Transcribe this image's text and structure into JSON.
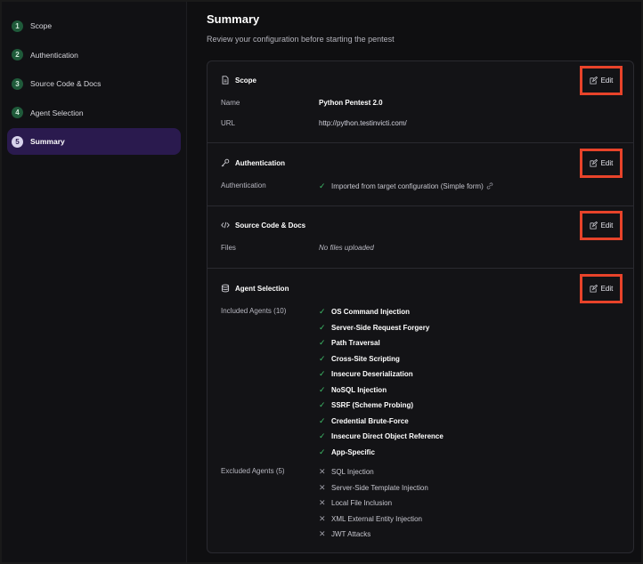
{
  "sidebar": {
    "steps": [
      {
        "num": "1",
        "label": "Scope"
      },
      {
        "num": "2",
        "label": "Authentication"
      },
      {
        "num": "3",
        "label": "Source Code & Docs"
      },
      {
        "num": "4",
        "label": "Agent Selection"
      },
      {
        "num": "5",
        "label": "Summary"
      }
    ],
    "active_step": 5
  },
  "header": {
    "title": "Summary",
    "subtitle": "Review your configuration before starting the pentest"
  },
  "edit_label": "Edit",
  "sections": {
    "scope": {
      "title": "Scope",
      "name_label": "Name",
      "name_value": "Python Pentest 2.0",
      "url_label": "URL",
      "url_value": "http://python.testinvicti.com/"
    },
    "auth": {
      "title": "Authentication",
      "label": "Authentication",
      "value": "Imported from target configuration (Simple form)"
    },
    "source": {
      "title": "Source Code & Docs",
      "label": "Files",
      "value": "No files uploaded"
    },
    "agents": {
      "title": "Agent Selection",
      "included_label": "Included Agents (10)",
      "included": [
        "OS Command Injection",
        "Server-Side Request Forgery",
        "Path Traversal",
        "Cross-Site Scripting",
        "Insecure Deserialization",
        "NoSQL Injection",
        "SSRF (Scheme Probing)",
        "Credential Brute-Force",
        "Insecure Direct Object Reference",
        "App-Specific"
      ],
      "excluded_label": "Excluded Agents (5)",
      "excluded": [
        "SQL Injection",
        "Server-Side Template Injection",
        "Local File Inclusion",
        "XML External Entity Injection",
        "JWT Attacks"
      ]
    }
  },
  "colors": {
    "accent_highlight": "#e8432a",
    "active_step_bg": "#2a1a4e",
    "check_green": "#3fbf6a",
    "step_done": "#1f5a3a"
  },
  "icons": {
    "scope": "document-icon",
    "auth": "key-icon",
    "source": "code-icon",
    "agents": "database-icon",
    "edit": "pencil-edit-icon",
    "included": "check-icon",
    "excluded": "x-icon",
    "auth_link": "link-icon"
  }
}
